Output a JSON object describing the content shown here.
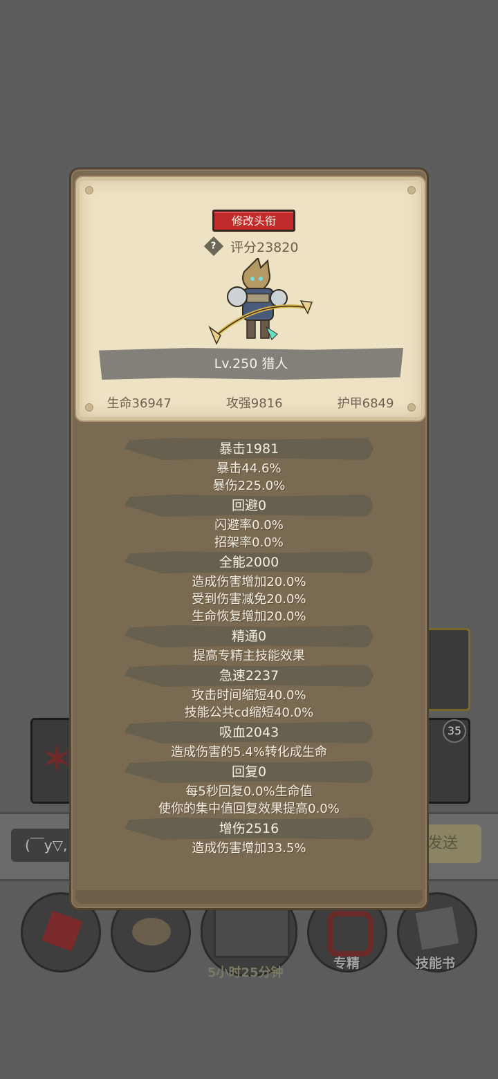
{
  "background": {
    "chat_text": "(￣y▽,",
    "send_label": "发送",
    "timer_text": "5小时25分钟",
    "badge_count": "35",
    "bottom_buttons": [
      "",
      "",
      "",
      "专精",
      "技能书"
    ]
  },
  "panel": {
    "title_button": "修改头衔",
    "help_symbol": "?",
    "score": "评分23820",
    "level_class": "Lv.250 猎人",
    "base_stats": [
      "生命36947",
      "攻强9816",
      "护甲6849"
    ],
    "groups": [
      {
        "title": "暴击1981",
        "lines": [
          "暴击44.6%",
          "暴伤225.0%"
        ]
      },
      {
        "title": "回避0",
        "lines": [
          "闪避率0.0%",
          "招架率0.0%"
        ]
      },
      {
        "title": "全能2000",
        "lines": [
          "造成伤害增加20.0%",
          "受到伤害减免20.0%",
          "生命恢复增加20.0%"
        ]
      },
      {
        "title": "精通0",
        "lines": [
          "提高专精主技能效果"
        ]
      },
      {
        "title": "急速2237",
        "lines": [
          "攻击时间缩短40.0%",
          "技能公共cd缩短40.0%"
        ]
      },
      {
        "title": "吸血2043",
        "lines": [
          "造成伤害的5.4%转化成生命"
        ]
      },
      {
        "title": "回复0",
        "lines": [
          "每5秒回复0.0%生命值",
          "使你的集中值回复效果提高0.0%"
        ]
      },
      {
        "title": "增伤2516",
        "lines": [
          "造成伤害增加33.5%"
        ]
      }
    ]
  },
  "colors": {
    "panel": "#7b6a52",
    "card": "#eee2c4",
    "title_button": "#c12b2b",
    "group_bar": "#68604f"
  }
}
